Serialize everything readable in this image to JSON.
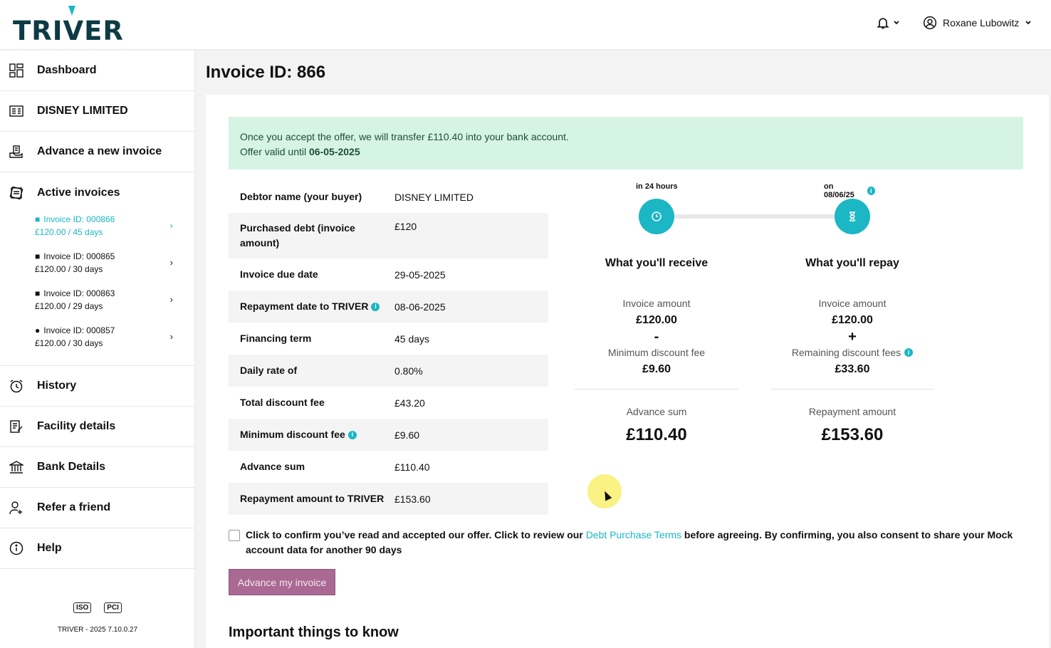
{
  "header": {
    "logo_text": "TRIVER",
    "user_name": "Roxane Lubowitz",
    "brand_color": "#1bb7c4"
  },
  "sidebar": {
    "items": [
      {
        "label": "Dashboard",
        "icon": "dashboard-icon"
      },
      {
        "label": "DISNEY LIMITED",
        "icon": "company-icon"
      },
      {
        "label": "Advance a new invoice",
        "icon": "invoice-hand-icon"
      },
      {
        "label": "Active invoices",
        "icon": "active-invoices-icon"
      },
      {
        "label": "History",
        "icon": "history-clock-icon"
      },
      {
        "label": "Facility details",
        "icon": "facility-icon"
      },
      {
        "label": "Bank Details",
        "icon": "bank-icon"
      },
      {
        "label": "Refer a friend",
        "icon": "refer-friend-icon"
      },
      {
        "label": "Help",
        "icon": "help-icon"
      }
    ],
    "active_invoices": [
      {
        "id": "Invoice ID: 000866",
        "detail": "£120.00 / 45 days",
        "icon": "clipboard-icon"
      },
      {
        "id": "Invoice ID: 000865",
        "detail": "£120.00 / 30 days",
        "icon": "clipboard-icon"
      },
      {
        "id": "Invoice ID: 000863",
        "detail": "£120.00 / 29 days",
        "icon": "clipboard-icon"
      },
      {
        "id": "Invoice ID: 000857",
        "detail": "£120.00 / 30 days",
        "icon": "car-icon"
      }
    ],
    "certs": [
      "ISO",
      "PCI"
    ],
    "version": "TRIVER - 2025 7.10.0.27"
  },
  "main": {
    "title": "Invoice ID: 866",
    "banner_line1": "Once you accept the offer, we will transfer £110.40 into your bank account.",
    "banner_line2_prefix": "Offer valid until ",
    "banner_line2_date": "06-05-2025",
    "details": [
      {
        "key": "Debtor name (your buyer)",
        "value": "DISNEY LIMITED",
        "info": false
      },
      {
        "key": "Purchased debt (invoice amount)",
        "value": "£120",
        "info": false
      },
      {
        "key": "Invoice due date",
        "value": "29-05-2025",
        "info": false
      },
      {
        "key": "Repayment date to TRIVER",
        "value": "08-06-2025",
        "info": true
      },
      {
        "key": "Financing term",
        "value": "45 days",
        "info": false
      },
      {
        "key": "Daily rate of",
        "value": "0.80%",
        "info": false
      },
      {
        "key": "Total discount fee",
        "value": "£43.20",
        "info": false
      },
      {
        "key": "Minimum discount fee",
        "value": "£9.60",
        "info": true
      },
      {
        "key": "Advance sum",
        "value": "£110.40",
        "info": false
      },
      {
        "key": "Repayment amount to TRIVER",
        "value": "£153.60",
        "info": false
      }
    ],
    "timeline": {
      "left_label": "in 24 hours",
      "right_label": "on 08/06/25"
    },
    "receive": {
      "title": "What you'll receive",
      "invoice_label": "Invoice amount",
      "invoice_amount": "£120.00",
      "operator": "-",
      "fee_label": "Minimum discount fee",
      "fee_amount": "£9.60",
      "total_label": "Advance sum",
      "total_amount": "£110.40"
    },
    "repay": {
      "title": "What you'll repay",
      "invoice_label": "Invoice amount",
      "invoice_amount": "£120.00",
      "operator": "+",
      "fee_label": "Remaining discount fees",
      "fee_amount": "£33.60",
      "total_label": "Repayment amount",
      "total_amount": "£153.60"
    },
    "confirm_pre": "Click to confirm you’ve read and accepted our offer. Click to review our ",
    "confirm_link": "Debt Purchase Terms",
    "confirm_post": " before agreeing. By confirming, you also consent to share your Mock account data for another 90 days",
    "advance_button": "Advance my invoice",
    "section_title": "Important things to know"
  }
}
